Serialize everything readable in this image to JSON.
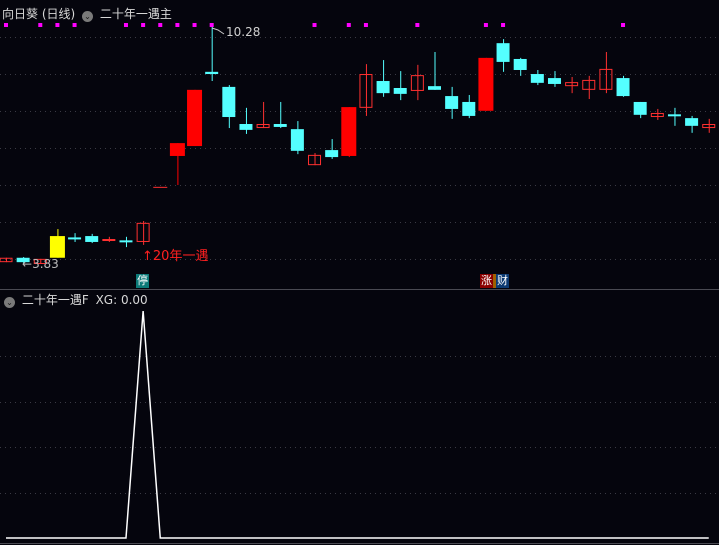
{
  "header": {
    "stock_name": "向日葵 (日线)",
    "indicator_main": "二十年一遇主",
    "indicator_sub": "二十年一遇F",
    "xg_label": "XG: 0.00"
  },
  "annotations": {
    "high_label": "10.28",
    "low_label": "3.83",
    "signal_label": "20年一遇",
    "tag_stop": "停",
    "tag_rise": "涨",
    "tag_wealth": "财"
  },
  "colors": {
    "background": "#05050d",
    "up": "#ff3030",
    "up_fill": "#ff0000",
    "down": "#54ffff",
    "highlight": "#ffff00",
    "signal_dot": "#ff00ff",
    "grid": "#3a3a44",
    "xg_line": "#ffffff"
  },
  "chart_data": {
    "type": "candlestick",
    "grid": true,
    "price_range": [
      3.83,
      10.28
    ],
    "candles": [
      {
        "o": 3.88,
        "h": 4.0,
        "l": 3.88,
        "c": 4.0,
        "style": "up"
      },
      {
        "o": 4.0,
        "h": 4.02,
        "l": 3.83,
        "c": 3.88,
        "style": "down"
      },
      {
        "o": 3.83,
        "h": 3.97,
        "l": 3.83,
        "c": 3.97,
        "style": "up"
      },
      {
        "o": 4.0,
        "h": 4.78,
        "l": 4.0,
        "c": 4.59,
        "style": "highlight"
      },
      {
        "o": 4.54,
        "h": 4.67,
        "l": 4.43,
        "c": 4.54,
        "style": "down"
      },
      {
        "o": 4.59,
        "h": 4.65,
        "l": 4.4,
        "c": 4.43,
        "style": "down"
      },
      {
        "o": 4.46,
        "h": 4.57,
        "l": 4.43,
        "c": 4.51,
        "style": "up"
      },
      {
        "o": 4.46,
        "h": 4.57,
        "l": 4.29,
        "c": 4.46,
        "style": "down"
      },
      {
        "o": 4.43,
        "h": 5.0,
        "l": 4.35,
        "c": 4.95,
        "style": "up"
      },
      {
        "o": 5.93,
        "h": 5.93,
        "l": 5.93,
        "c": 5.93,
        "style": "up"
      },
      {
        "o": 6.77,
        "h": 7.12,
        "l": 5.98,
        "c": 7.12,
        "style": "up_fill"
      },
      {
        "o": 7.04,
        "h": 8.57,
        "l": 7.04,
        "c": 8.57,
        "style": "up_fill"
      },
      {
        "o": 9.06,
        "h": 10.28,
        "l": 8.81,
        "c": 9.0,
        "style": "down"
      },
      {
        "o": 8.65,
        "h": 8.7,
        "l": 7.53,
        "c": 7.83,
        "style": "down"
      },
      {
        "o": 7.64,
        "h": 8.08,
        "l": 7.37,
        "c": 7.48,
        "style": "down"
      },
      {
        "o": 7.53,
        "h": 8.24,
        "l": 7.53,
        "c": 7.64,
        "style": "up"
      },
      {
        "o": 7.64,
        "h": 8.24,
        "l": 7.53,
        "c": 7.56,
        "style": "down"
      },
      {
        "o": 7.5,
        "h": 7.72,
        "l": 6.82,
        "c": 6.91,
        "style": "down"
      },
      {
        "o": 6.52,
        "h": 6.85,
        "l": 6.52,
        "c": 6.8,
        "style": "up"
      },
      {
        "o": 6.93,
        "h": 7.23,
        "l": 6.69,
        "c": 6.74,
        "style": "down"
      },
      {
        "o": 6.77,
        "h": 8.1,
        "l": 6.74,
        "c": 8.1,
        "style": "up_fill"
      },
      {
        "o": 8.08,
        "h": 9.27,
        "l": 7.86,
        "c": 9.0,
        "style": "up"
      },
      {
        "o": 8.81,
        "h": 9.38,
        "l": 8.38,
        "c": 8.48,
        "style": "down"
      },
      {
        "o": 8.62,
        "h": 9.08,
        "l": 8.29,
        "c": 8.46,
        "style": "down"
      },
      {
        "o": 8.54,
        "h": 9.25,
        "l": 8.29,
        "c": 8.97,
        "style": "up"
      },
      {
        "o": 8.67,
        "h": 9.6,
        "l": 8.57,
        "c": 8.57,
        "style": "down"
      },
      {
        "o": 8.4,
        "h": 8.65,
        "l": 7.78,
        "c": 8.05,
        "style": "down"
      },
      {
        "o": 8.24,
        "h": 8.43,
        "l": 7.8,
        "c": 7.86,
        "style": "down"
      },
      {
        "o": 8.0,
        "h": 9.44,
        "l": 8.0,
        "c": 9.44,
        "style": "up_fill"
      },
      {
        "o": 9.84,
        "h": 9.95,
        "l": 9.06,
        "c": 9.33,
        "style": "down"
      },
      {
        "o": 9.41,
        "h": 9.44,
        "l": 8.95,
        "c": 9.11,
        "style": "down"
      },
      {
        "o": 9.0,
        "h": 9.11,
        "l": 8.7,
        "c": 8.76,
        "style": "down"
      },
      {
        "o": 8.89,
        "h": 9.08,
        "l": 8.65,
        "c": 8.73,
        "style": "down"
      },
      {
        "o": 8.67,
        "h": 8.92,
        "l": 8.48,
        "c": 8.78,
        "style": "up"
      },
      {
        "o": 8.57,
        "h": 8.95,
        "l": 8.32,
        "c": 8.84,
        "style": "up"
      },
      {
        "o": 8.57,
        "h": 9.6,
        "l": 8.48,
        "c": 9.14,
        "style": "up"
      },
      {
        "o": 8.89,
        "h": 8.95,
        "l": 8.38,
        "c": 8.4,
        "style": "down"
      },
      {
        "o": 8.24,
        "h": 8.24,
        "l": 7.8,
        "c": 7.89,
        "style": "down"
      },
      {
        "o": 7.83,
        "h": 8.05,
        "l": 7.75,
        "c": 7.94,
        "style": "up"
      },
      {
        "o": 7.89,
        "h": 8.08,
        "l": 7.59,
        "c": 7.89,
        "style": "down"
      },
      {
        "o": 7.8,
        "h": 7.86,
        "l": 7.4,
        "c": 7.59,
        "style": "down"
      },
      {
        "o": 7.53,
        "h": 7.78,
        "l": 7.4,
        "c": 7.64,
        "style": "up"
      }
    ],
    "signal_dot_candles": [
      1,
      3,
      4,
      5,
      8,
      9,
      10,
      11,
      12,
      13,
      19,
      21,
      22,
      25,
      29,
      30,
      37
    ],
    "xg_series": [
      0,
      0,
      0,
      0,
      0,
      0,
      0,
      0,
      1,
      0,
      0,
      0,
      0,
      0,
      0,
      0,
      0,
      0,
      0,
      0,
      0,
      0,
      0,
      0,
      0,
      0,
      0,
      0,
      0,
      0,
      0,
      0,
      0,
      0,
      0,
      0,
      0,
      0,
      0,
      0,
      0,
      0
    ],
    "xg_range": [
      0,
      1
    ]
  }
}
